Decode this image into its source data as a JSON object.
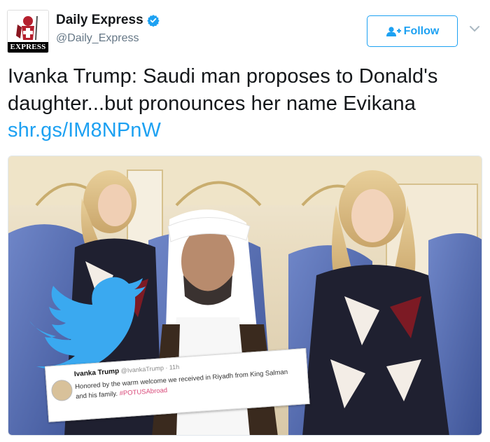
{
  "account": {
    "name": "Daily Express",
    "handle": "@Daily_Express",
    "avatar_text": "EXPRESS",
    "verified": true
  },
  "follow_button": {
    "label": "Follow",
    "icon": "add-user-icon"
  },
  "menu_icon": "chevron-down-icon",
  "tweet": {
    "text": "Ivanka Trump: Saudi man proposes to Donald's daughter...but pronounces her name Evikana",
    "link": "shr.gs/IM8NPnW"
  },
  "media": {
    "embedded_tweet": {
      "name": "Ivanka Trump",
      "handle": "@IvankaTrump · 11h",
      "text": "Honored by the warm welcome we received in Riyadh from King Salman and his family.",
      "hashtag": "#POTUSAbroad"
    }
  },
  "colors": {
    "accent": "#1da1f2",
    "text": "#14171a",
    "muted": "#657786"
  }
}
